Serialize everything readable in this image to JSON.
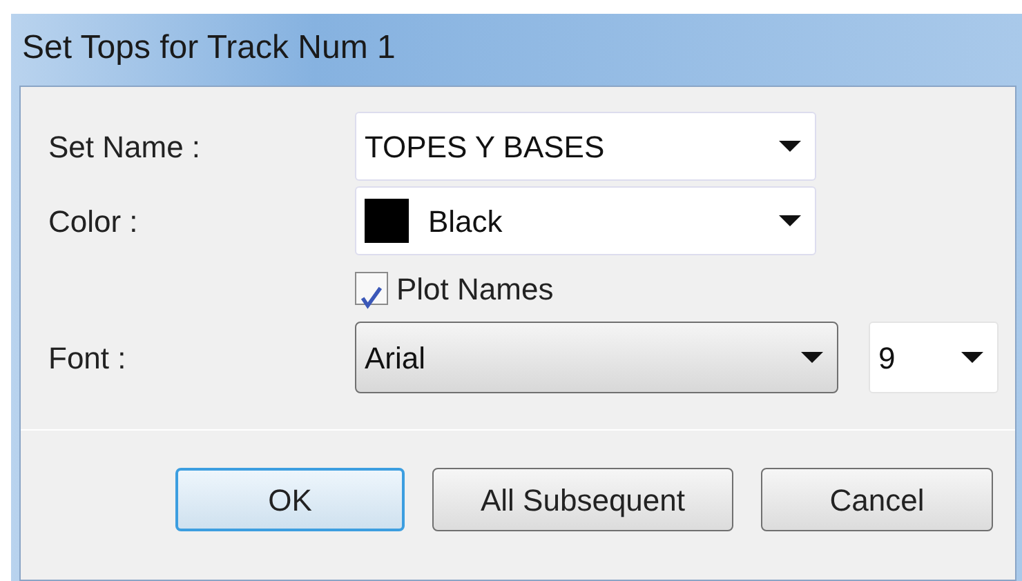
{
  "window": {
    "title": "Set Tops for Track Num 1"
  },
  "set_name": {
    "label": "Set Name :",
    "value": "TOPES Y BASES"
  },
  "color": {
    "label": "Color :",
    "value": "Black",
    "color": "#000000"
  },
  "plot_names": {
    "label": "Plot Names",
    "checked": true
  },
  "font": {
    "label": "Font :",
    "value": "Arial"
  },
  "font_size": {
    "value": "9"
  },
  "buttons": [
    {
      "label": "OK",
      "default": true
    },
    {
      "label": "All Subsequent",
      "default": false
    },
    {
      "label": "Cancel",
      "default": false
    }
  ]
}
